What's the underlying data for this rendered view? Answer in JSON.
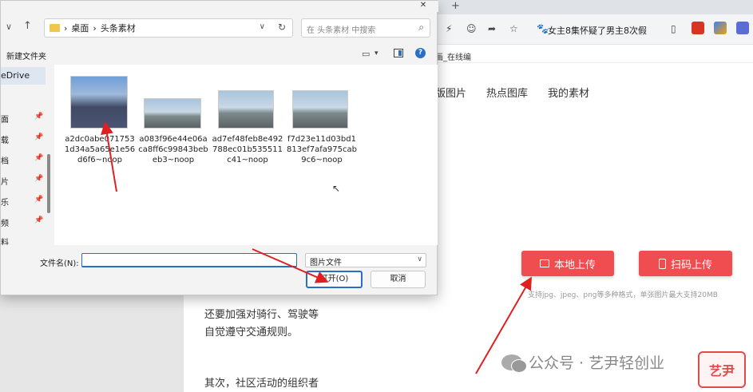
{
  "browser": {
    "new_tab": "+",
    "tab_title": "女主8集怀疑了男主8次假",
    "bookmark": "画_在线编"
  },
  "page": {
    "nav_tabs": [
      "版图片",
      "热点图库",
      "我的素材"
    ],
    "local_upload": "本地上传",
    "qr_upload": "扫码上传",
    "upload_hint": "支持jpg、jpeg、png等多种格式，单张图片最大支持20MB",
    "article_lines": [
      "还要加强对骑行、驾驶等",
      "自觉遵守交通规则。",
      "其次，社区活动的组织者"
    ]
  },
  "watermark": {
    "text": "公众号 · 艺尹轻创业",
    "logo": "艺尹"
  },
  "dialog": {
    "address_path": [
      "桌面",
      "头条素材"
    ],
    "search_placeholder": "在 头条素材 中搜索",
    "new_folder": "新建文件夹",
    "nav_items": [
      {
        "label": "eDrive",
        "pinned": false
      },
      {
        "label": "面",
        "pinned": true
      },
      {
        "label": "载",
        "pinned": true
      },
      {
        "label": "档",
        "pinned": true
      },
      {
        "label": "片",
        "pinned": true
      },
      {
        "label": "乐",
        "pinned": true
      },
      {
        "label": "频",
        "pinned": true
      },
      {
        "label": "料",
        "pinned": false
      }
    ],
    "files": [
      {
        "name": "a2dc0abe0717531d34a5a65e1e56d6f6~noop"
      },
      {
        "name": "a083f96e44e06aca8ff6c99843bebeb3~noop"
      },
      {
        "name": "ad7ef48feb8e492788ec01b535511c41~noop"
      },
      {
        "name": "f7d23e11d03bd1813ef7afa975cab9c6~noop"
      }
    ],
    "filename_label": "文件名(N):",
    "filename_value": "",
    "filetype": "图片文件",
    "open_button": "打开(O)",
    "cancel_button": "取消"
  },
  "colors": {
    "accent_red": "#ef4d4f",
    "dialog_blue": "#2a6ec9",
    "arrow_red": "#e02020"
  }
}
